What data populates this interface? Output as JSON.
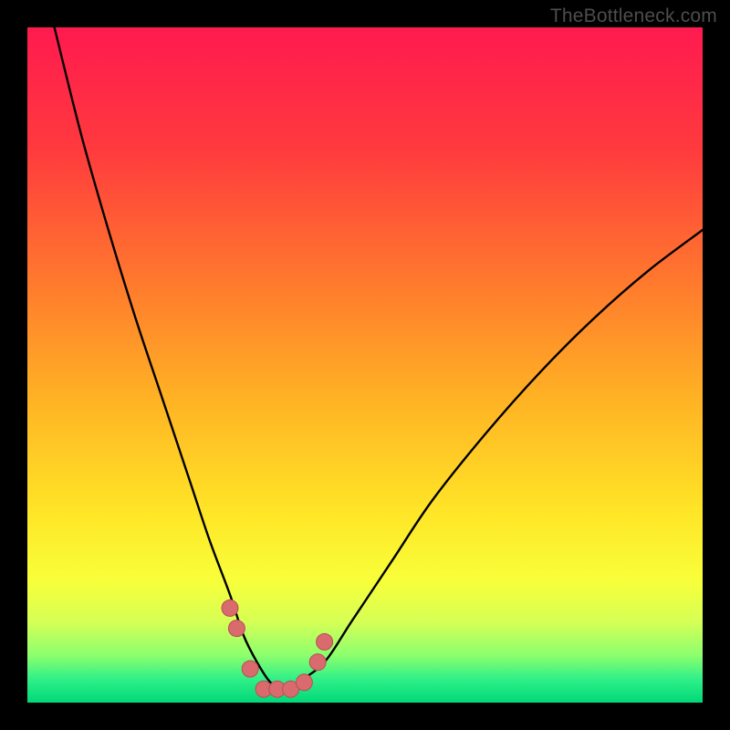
{
  "watermark": "TheBottleneck.com",
  "colors": {
    "black": "#000000",
    "curve": "#000000",
    "marker_fill": "#d96a6e",
    "marker_stroke": "#b94f54",
    "gradient_stops": [
      {
        "offset": 0.0,
        "color": "#ff1a4f"
      },
      {
        "offset": 0.18,
        "color": "#ff3a3e"
      },
      {
        "offset": 0.38,
        "color": "#ff7a2d"
      },
      {
        "offset": 0.55,
        "color": "#ffb224"
      },
      {
        "offset": 0.72,
        "color": "#ffe627"
      },
      {
        "offset": 0.82,
        "color": "#f8ff3a"
      },
      {
        "offset": 0.88,
        "color": "#d6ff55"
      },
      {
        "offset": 0.93,
        "color": "#8cff6e"
      },
      {
        "offset": 0.965,
        "color": "#30f088"
      },
      {
        "offset": 1.0,
        "color": "#00d878"
      }
    ]
  },
  "chart_data": {
    "type": "line",
    "title": "",
    "xlabel": "",
    "ylabel": "",
    "xlim": [
      0,
      100
    ],
    "ylim": [
      0,
      100
    ],
    "grid": false,
    "legend": false,
    "series": [
      {
        "name": "bottleneck-curve",
        "x": [
          4,
          8,
          12,
          16,
          20,
          24,
          27,
          30,
          32,
          34,
          36,
          38,
          40,
          44,
          48,
          54,
          60,
          68,
          76,
          84,
          92,
          100
        ],
        "y": [
          100,
          84,
          70,
          57,
          45,
          33,
          24,
          16,
          10,
          6,
          3,
          2,
          3,
          6,
          12,
          21,
          30,
          40,
          49,
          57,
          64,
          70
        ]
      }
    ],
    "markers": {
      "name": "highlighted-points",
      "x": [
        30,
        31,
        33,
        35,
        37,
        39,
        41,
        43,
        44
      ],
      "y": [
        14,
        11,
        5,
        2,
        2,
        2,
        3,
        6,
        9
      ]
    }
  }
}
